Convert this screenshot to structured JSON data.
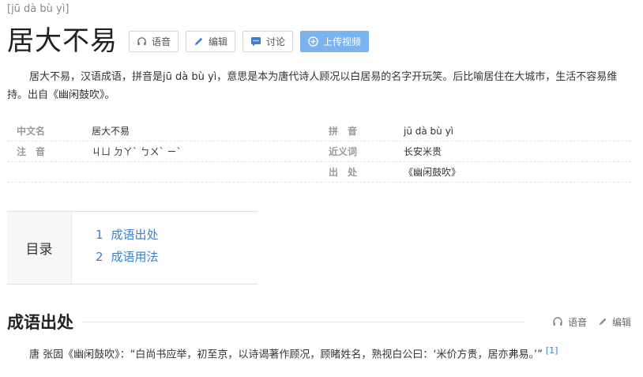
{
  "header": {
    "pinyin": "[jū dà bù yì]",
    "title": "居大不易",
    "buttons": {
      "voice": "语音",
      "edit": "编辑",
      "discuss": "讨论",
      "upload_video": "上传视频"
    }
  },
  "summary": "居大不易，汉语成语，拼音是jū dà bù yì，意思是本为唐代诗人顾况以白居易的名字开玩笑。后比喻居住在大城市，生活不容易维持。出自《幽闲鼓吹》。",
  "basic_info": {
    "rows": [
      {
        "k1": "中文名",
        "v1": "居大不易",
        "k2": "拼　音",
        "v2": "jū dà bù yì"
      },
      {
        "k1": "注　音",
        "v1": "ㄐㄩ ㄉㄚˋ ㄅㄨˋ ㄧˋ",
        "k2": "近义词",
        "v2": "长安米贵"
      },
      {
        "k1": "",
        "v1": "",
        "k2": "出　处",
        "v2": "《幽闲鼓吹》"
      }
    ]
  },
  "toc": {
    "label": "目录",
    "items": [
      {
        "num": "1",
        "label": "成语出处"
      },
      {
        "num": "2",
        "label": "成语用法"
      }
    ]
  },
  "section": {
    "title": "成语出处",
    "voice": "语音",
    "edit": "编辑",
    "body": "唐 张固《幽闲鼓吹》：“白尚书应举，初至京，以诗谒著作顾况，顾睹姓名，熟视白公曰：‘米价方贵，居亦弗易。’”",
    "ref": "[1]"
  },
  "colors": {
    "accent": "#7bb3ef",
    "link": "#3f7fc8"
  }
}
